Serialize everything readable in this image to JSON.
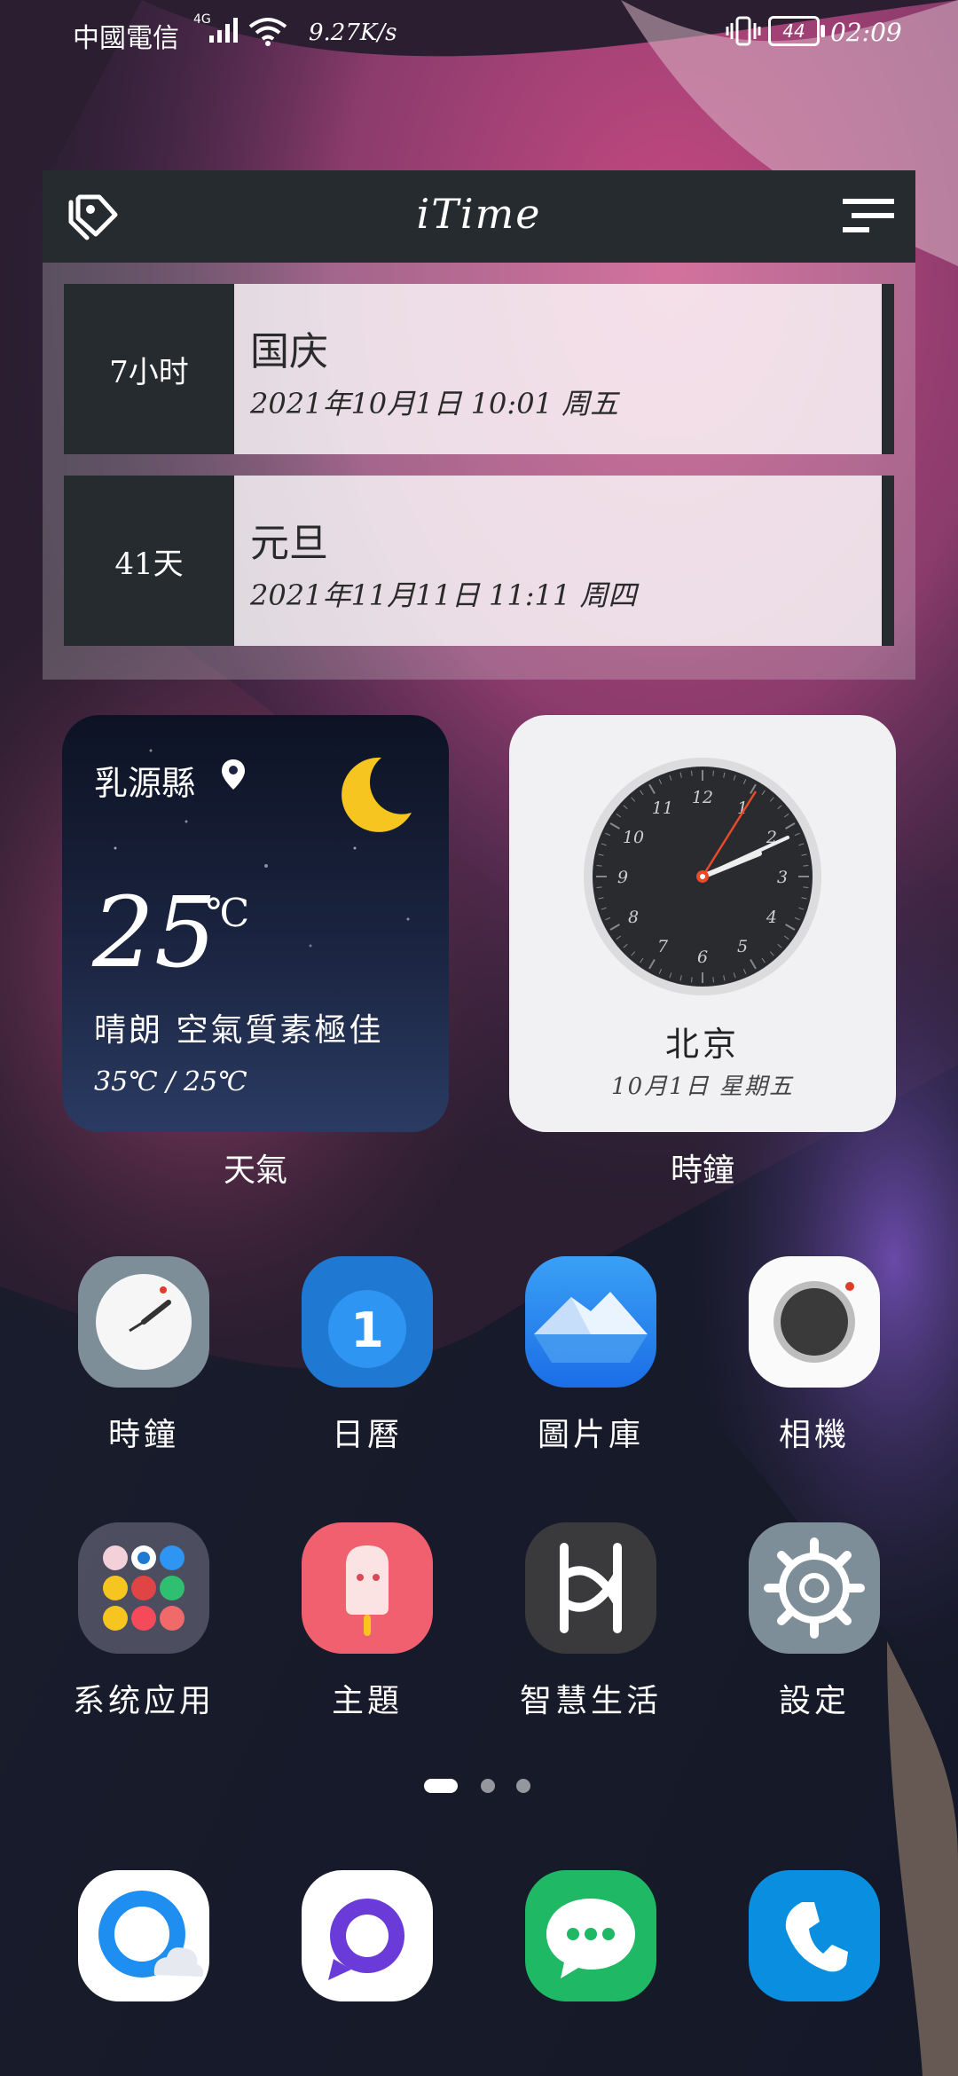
{
  "status_bar": {
    "carrier": "中國電信",
    "network": "4G",
    "speed": "9.27K/s",
    "battery": "44",
    "time": "02:09"
  },
  "itime": {
    "title": "iTime",
    "events": [
      {
        "countdown": "7小时",
        "name": "国庆",
        "date": "2021年10月1日  10:01 周五"
      },
      {
        "countdown": "41天",
        "name": "元旦",
        "date": "2021年11月11日  11:11 周四"
      }
    ]
  },
  "weather": {
    "city": "乳源縣",
    "temperature": "25",
    "unit": "℃",
    "condition": "晴朗 空氣質素極佳",
    "range": "35℃  / 25℃",
    "label": "天氣"
  },
  "clock": {
    "city": "北京",
    "date": "10月1日  星期五",
    "label": "時鐘",
    "dial_numbers": [
      "12",
      "1",
      "2",
      "3",
      "4",
      "5",
      "6",
      "7",
      "8",
      "9",
      "10",
      "11"
    ]
  },
  "apps": [
    {
      "label": "時鐘",
      "icon": "clock-app-icon"
    },
    {
      "label": "日曆",
      "icon": "calendar-icon",
      "badge": "1"
    },
    {
      "label": "圖片庫",
      "icon": "gallery-icon"
    },
    {
      "label": "相機",
      "icon": "camera-icon"
    },
    {
      "label": "系统应用",
      "icon": "folder-icon"
    },
    {
      "label": "主題",
      "icon": "themes-icon"
    },
    {
      "label": "智慧生活",
      "icon": "smart-life-icon"
    },
    {
      "label": "設定",
      "icon": "settings-icon"
    }
  ],
  "dock": [
    "browser-icon",
    "messages-bubble-icon",
    "chat-icon",
    "phone-icon"
  ],
  "pages": {
    "count": 3,
    "current": 1
  },
  "colors": {
    "widget_dark": "#262b30",
    "calendar_blue": "#1f78d1",
    "themes_pink": "#f0606e",
    "messaging_green": "#1fb864",
    "phone_blue": "#0a8fe0"
  }
}
